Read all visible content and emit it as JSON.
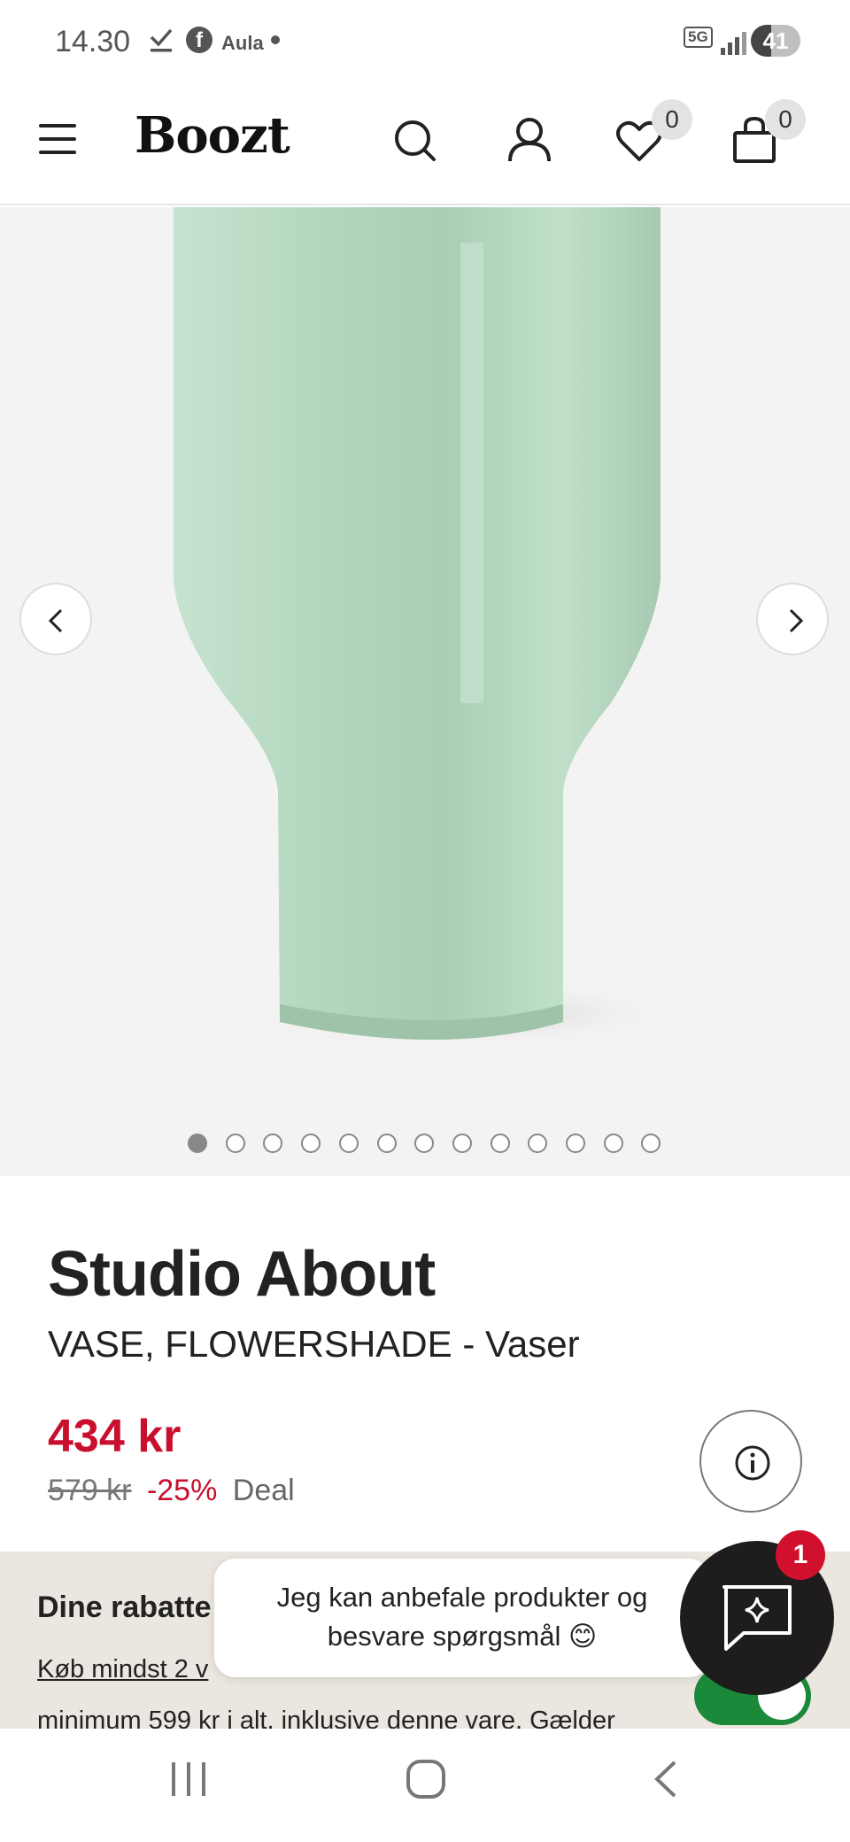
{
  "status_bar": {
    "time": "14.30",
    "app_label": "Aula",
    "network": "5G",
    "battery": "41",
    "battery_level": 0.41,
    "icons": [
      "check-icon",
      "facebook-icon",
      "aula-icon",
      "notification-dot-icon",
      "5g-icon",
      "signal-icon",
      "battery-icon"
    ]
  },
  "header": {
    "logo": "Boozt",
    "wishlist_count": "0",
    "cart_count": "0",
    "icons": [
      "hamburger-menu-icon",
      "search-icon",
      "account-icon",
      "heart-icon",
      "shopping-bag-icon"
    ]
  },
  "gallery": {
    "image_alt": "Mint green vase",
    "vase_color": "#b9d9c4",
    "background_color": "#f3f3f3",
    "total_images": 13,
    "active_index": 0,
    "icons": [
      "chevron-left-icon",
      "chevron-right-icon"
    ]
  },
  "product": {
    "brand": "Studio About",
    "name": "VASE, FLOWERSHADE - Vaser",
    "price": "434 kr",
    "old_price": "579 kr",
    "discount": "-25%",
    "deal_label": "Deal",
    "price_color": "#c8102e"
  },
  "discounts": {
    "title": "Dine rabatte",
    "text_line1": "Køb mindst 2 v",
    "text_line2": "minimum 599 kr i alt, inklusive denne vare. Gælder",
    "toggle_on": true,
    "toggle_color": "#1a8a3a"
  },
  "chat": {
    "message_line1": "Jeg kan anbefale produkter og",
    "message_line2": "besvare spørgsmål 😊",
    "unread_count": "1",
    "icons": [
      "chat-sparkle-icon"
    ]
  },
  "system_nav": {
    "icons": [
      "recent-apps-icon",
      "home-icon",
      "back-icon"
    ]
  }
}
